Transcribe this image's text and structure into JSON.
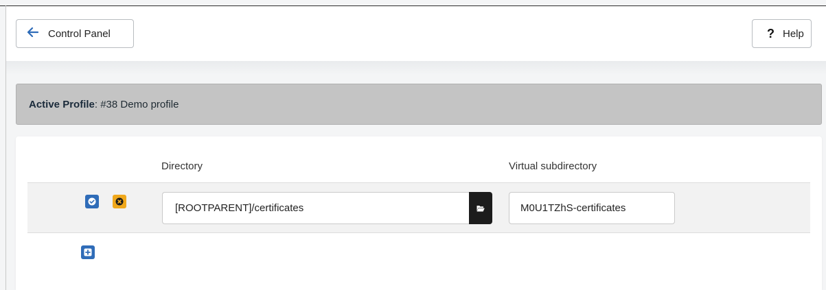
{
  "toolbar": {
    "back_label": "Control Panel",
    "help_icon_text": "?",
    "help_label": "Help"
  },
  "profile": {
    "label": "Active Profile",
    "value": ": #38 Demo profile"
  },
  "table": {
    "columns": [
      "Directory",
      "Virtual subdirectory"
    ],
    "rows": [
      {
        "directory": "[ROOTPARENT]/certificates",
        "virtual_subdirectory": "M0U1TZhS-certificates"
      }
    ]
  },
  "colors": {
    "primary": "#2f6cb8",
    "warning": "#f0a81c",
    "dark": "#1c1c1c",
    "profile_bar": "#c4c4c4"
  },
  "icons": {
    "back": "arrow-left-icon",
    "save": "check-circle-icon",
    "cancel": "times-circle-icon",
    "browse": "folder-open-icon",
    "add": "plus-square-icon"
  }
}
